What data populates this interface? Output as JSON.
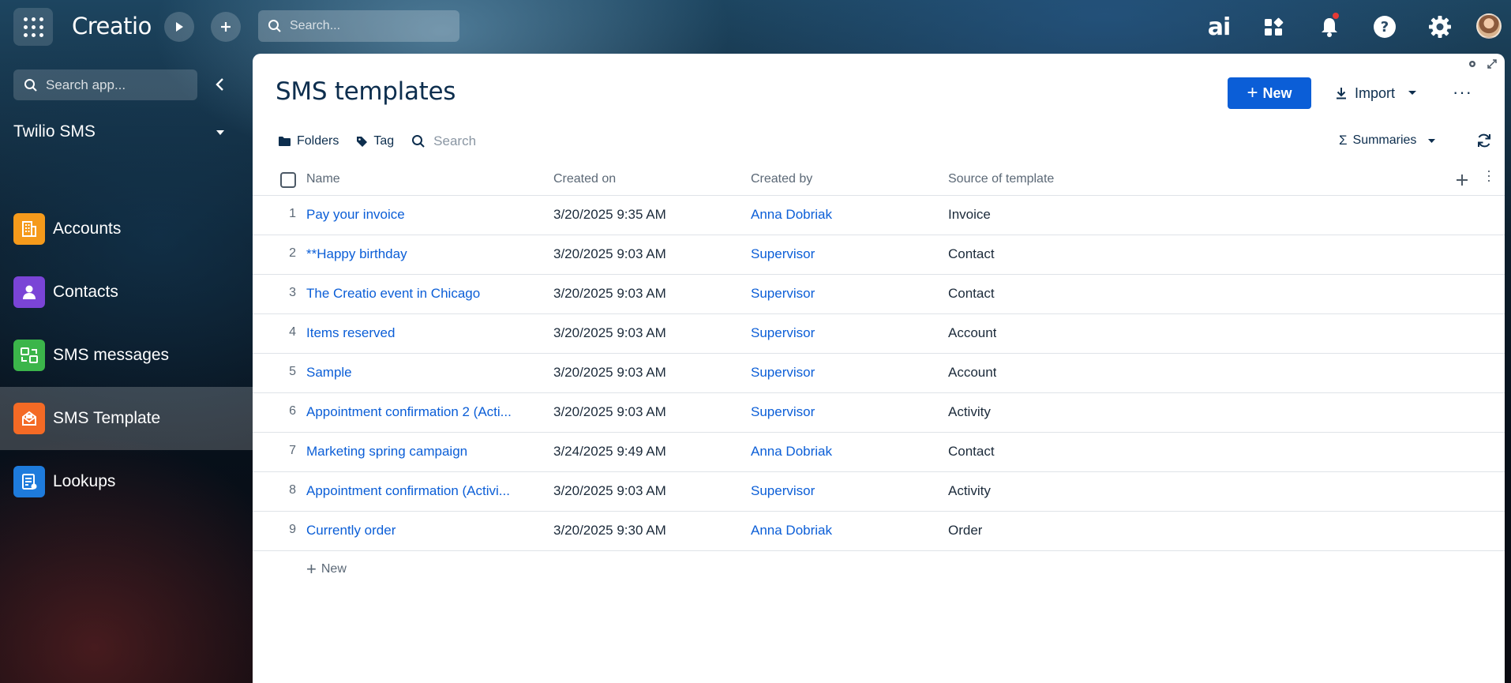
{
  "topbar": {
    "brand": "Creatio",
    "search_placeholder": "Search...",
    "ai_label": "ai"
  },
  "sidebar": {
    "search_placeholder": "Search app...",
    "app_title": "Twilio SMS",
    "items": [
      {
        "label": "Accounts",
        "icon": "building-icon",
        "color": "#f59a1b"
      },
      {
        "label": "Contacts",
        "icon": "person-icon",
        "color": "#7a44d6"
      },
      {
        "label": "SMS messages",
        "icon": "sms-icon",
        "color": "#3bb54a"
      },
      {
        "label": "SMS Template",
        "icon": "envelope-icon",
        "color": "#f46a25",
        "active": true
      },
      {
        "label": "Lookups",
        "icon": "list-icon",
        "color": "#1e7bdc"
      }
    ]
  },
  "page": {
    "title": "SMS templates",
    "new_label": "New",
    "import_label": "Import",
    "folders_label": "Folders",
    "tag_label": "Tag",
    "search_placeholder": "Search",
    "summaries_label": "Summaries",
    "add_row_label": "New"
  },
  "table": {
    "columns": [
      "Name",
      "Created on",
      "Created by",
      "Source of template"
    ],
    "rows": [
      {
        "num": "1",
        "name": "Pay your invoice",
        "created_on": "3/20/2025 9:35 AM",
        "created_by": "Anna Dobriak",
        "source": "Invoice"
      },
      {
        "num": "2",
        "name": "**Happy birthday",
        "created_on": "3/20/2025 9:03 AM",
        "created_by": "Supervisor",
        "source": "Contact"
      },
      {
        "num": "3",
        "name": "The Creatio event in Chicago",
        "created_on": "3/20/2025 9:03 AM",
        "created_by": "Supervisor",
        "source": "Contact"
      },
      {
        "num": "4",
        "name": "Items reserved",
        "created_on": "3/20/2025 9:03 AM",
        "created_by": "Supervisor",
        "source": "Account"
      },
      {
        "num": "5",
        "name": "Sample",
        "created_on": "3/20/2025 9:03 AM",
        "created_by": "Supervisor",
        "source": "Account"
      },
      {
        "num": "6",
        "name": "Appointment confirmation 2 (Acti...",
        "created_on": "3/20/2025 9:03 AM",
        "created_by": "Supervisor",
        "source": "Activity"
      },
      {
        "num": "7",
        "name": "Marketing spring campaign",
        "created_on": "3/24/2025 9:49 AM",
        "created_by": "Anna Dobriak",
        "source": "Contact"
      },
      {
        "num": "8",
        "name": "Appointment confirmation (Activi...",
        "created_on": "3/20/2025 9:03 AM",
        "created_by": "Supervisor",
        "source": "Activity"
      },
      {
        "num": "9",
        "name": "Currently order",
        "created_on": "3/20/2025 9:30 AM",
        "created_by": "Anna Dobriak",
        "source": "Order"
      }
    ]
  }
}
